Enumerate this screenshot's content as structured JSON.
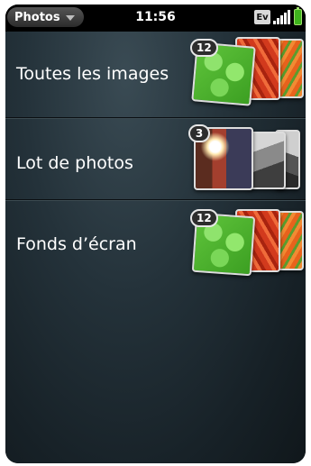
{
  "status_bar": {
    "app_menu_label": "Photos",
    "time": "11:56",
    "network_label": "Ev"
  },
  "albums": [
    {
      "label": "Toutes les images",
      "count": "12"
    },
    {
      "label": "Lot de photos",
      "count": "3"
    },
    {
      "label": "Fonds d’écran",
      "count": "12"
    }
  ]
}
